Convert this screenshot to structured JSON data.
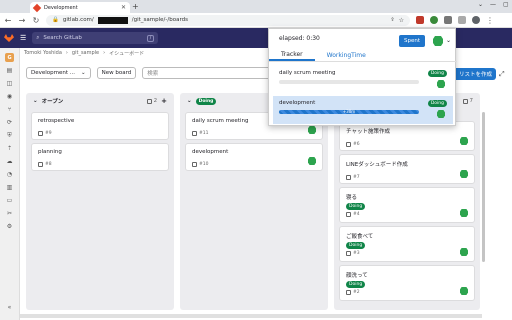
{
  "browser": {
    "tab_title": "Development",
    "url_prefix": "gitlab.com/",
    "url_suffix": "/git_sample/-/boards"
  },
  "gitlab": {
    "search_placeholder": "Search GitLab",
    "search_shortcut": "/",
    "breadcrumb": [
      "Tomoki Yoshida",
      "git_sample",
      "イシューボード"
    ]
  },
  "filters": {
    "select_label": "Development ...",
    "new_board_label": "New board",
    "search_placeholder": "検索",
    "create_list_label": "リストを作成"
  },
  "columns": [
    {
      "title": "オープン",
      "count": "2",
      "cards": [
        {
          "title": "retrospective",
          "number": "#9"
        },
        {
          "title": "planning",
          "number": "#8"
        }
      ]
    },
    {
      "badge": "Doing",
      "cards": [
        {
          "title": "daily scrum meeting",
          "number": "#11"
        },
        {
          "title": "development",
          "number": "#10"
        }
      ]
    },
    {
      "count": "7",
      "cards": [
        {
          "title": "チャット施策作成",
          "number": "#6"
        },
        {
          "title": "LINEダッシュボード作成",
          "number": "#7"
        },
        {
          "title": "寝る",
          "badge": "Doing",
          "number": "#4"
        },
        {
          "title": "ご飯食べて",
          "badge": "Doing",
          "number": "#3"
        },
        {
          "title": "顔洗って",
          "badge": "Doing",
          "number": "#2"
        }
      ]
    }
  ],
  "popup": {
    "elapsed": "elapsed: 0:30",
    "spent_label": "Spent",
    "tabs": [
      "Tracker",
      "WorkingTime"
    ],
    "rows": [
      {
        "title": "daily scrum meeting",
        "badge": "Doing",
        "progress": 0
      },
      {
        "title": "development",
        "badge": "Doing",
        "progress": 1,
        "progress_label": "+30m"
      }
    ]
  },
  "colors": {
    "brand": "#292961",
    "accent": "#1f75cb",
    "doing": "#108548"
  }
}
